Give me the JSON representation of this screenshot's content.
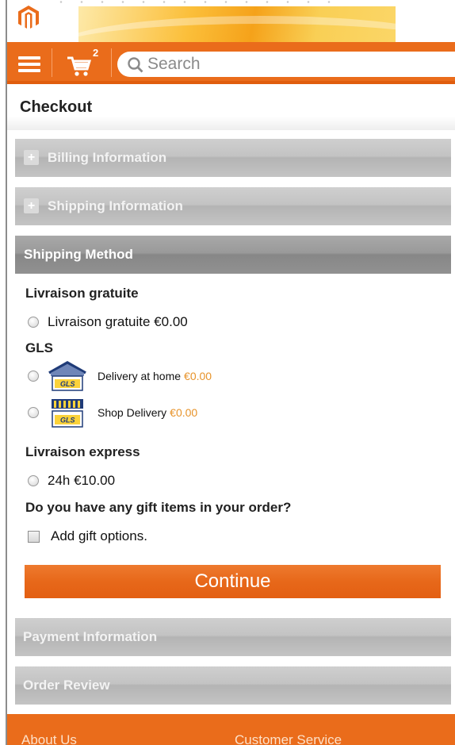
{
  "header": {
    "cart_count": "2",
    "search_placeholder": "Search",
    "colors": {
      "brand": "#ea6c1b",
      "accent_price": "#e7932a"
    }
  },
  "page": {
    "title": "Checkout"
  },
  "steps": {
    "billing": "Billing Information",
    "shipping": "Shipping Information",
    "method": "Shipping Method",
    "payment": "Payment Information",
    "review": "Order Review"
  },
  "shipping_method": {
    "groups": [
      {
        "title": "Livraison gratuite",
        "options": [
          {
            "label": "Livraison gratuite €0.00"
          }
        ]
      },
      {
        "title": "GLS",
        "options": [
          {
            "label": "Delivery at home",
            "price": "€0.00",
            "icon": "gls-home-icon"
          },
          {
            "label": "Shop Delivery",
            "price": "€0.00",
            "icon": "gls-shop-icon"
          }
        ]
      },
      {
        "title": "Livraison express",
        "options": [
          {
            "label": "24h €10.00"
          }
        ]
      }
    ],
    "gift_question": "Do you have any gift items in your order?",
    "gift_option": "Add gift options.",
    "continue_label": "Continue"
  },
  "footer": {
    "about": "About Us",
    "service": "Customer Service"
  }
}
